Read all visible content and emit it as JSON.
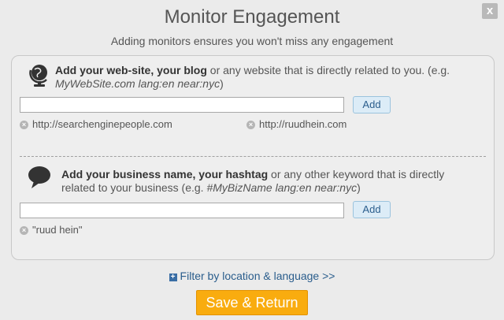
{
  "dialog": {
    "title": "Monitor Engagement",
    "subtitle": "Adding monitors ensures you won't miss any engagement",
    "close_label": "x"
  },
  "website_section": {
    "icon": "globe-icon",
    "heading_bold": "Add your web-site, your blog",
    "heading_rest": " or any website that is directly related to you. (e.g. ",
    "example": "MyWebSite.com lang:en near:nyc",
    "heading_end": ")",
    "input_value": "",
    "add_label": "Add",
    "chips": [
      "http://searchenginepeople.com",
      "http://ruudhein.com"
    ]
  },
  "keyword_section": {
    "icon": "speech-bubble-icon",
    "heading_bold": "Add your business name, your hashtag",
    "heading_rest": " or any other keyword that is directly related to your business (e.g. ",
    "example": "#MyBizName lang:en near:nyc",
    "heading_end": ")",
    "input_value": "",
    "add_label": "Add",
    "chips": [
      "\"ruud hein\""
    ]
  },
  "filter_link": {
    "icon": "plus-icon",
    "label": "Filter by location & language >>"
  },
  "save_button": {
    "label": "Save & Return"
  },
  "colors": {
    "accent_orange": "#f9ac0f",
    "link_blue": "#2a5d8c",
    "add_button_bg": "#dcecf7"
  }
}
